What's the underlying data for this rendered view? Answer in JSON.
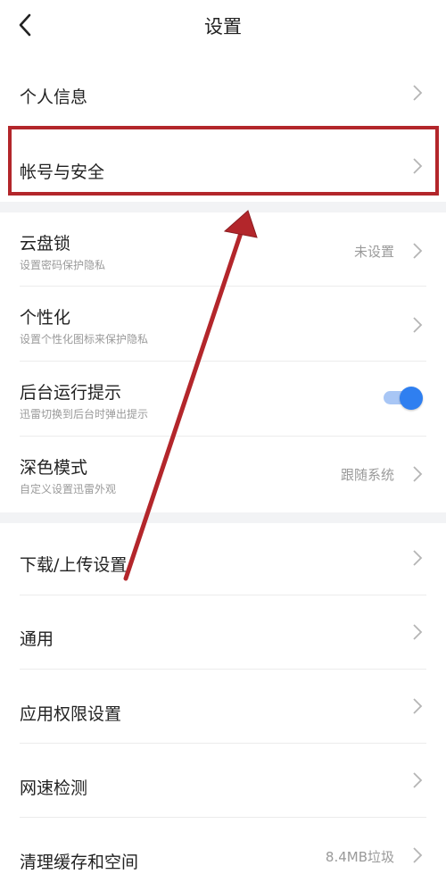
{
  "header": {
    "title": "设置",
    "back_icon": "chevron-left-icon"
  },
  "settings": {
    "personal_info": {
      "label": "个人信息"
    },
    "account_security": {
      "label": "帐号与安全"
    },
    "cloud_lock": {
      "label": "云盘锁",
      "subtitle": "设置密码保护隐私",
      "value": "未设置"
    },
    "personalize": {
      "label": "个性化",
      "subtitle": "设置个性化图标来保护隐私"
    },
    "background_tip": {
      "label": "后台运行提示",
      "subtitle": "迅雷切换到后台时弹出提示",
      "toggle_on": true
    },
    "dark_mode": {
      "label": "深色模式",
      "subtitle": "自定义设置迅雷外观",
      "value": "跟随系统"
    },
    "download_upload": {
      "label": "下载/上传设置"
    },
    "general": {
      "label": "通用"
    },
    "app_permissions": {
      "label": "应用权限设置"
    },
    "speed_test": {
      "label": "网速检测"
    },
    "clear_cache": {
      "label": "清理缓存和空间",
      "value": "8.4MB垃圾"
    }
  },
  "colors": {
    "accent": "#2f7ff0",
    "annotation": "#b3262b",
    "section_gap": "#f2f3f5"
  }
}
